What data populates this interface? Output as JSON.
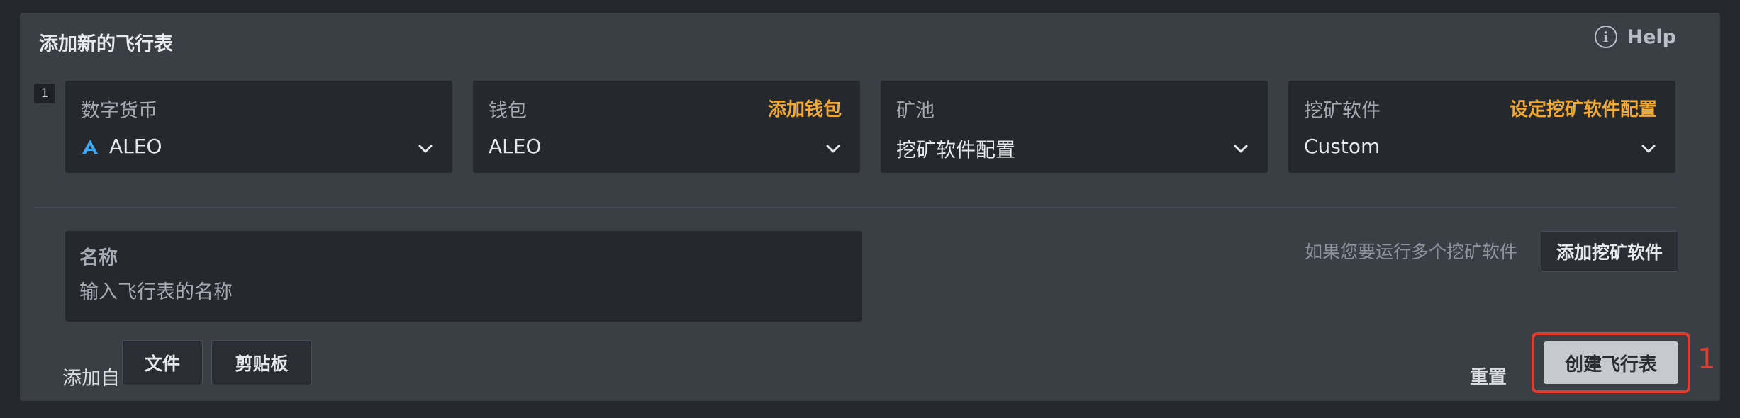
{
  "panel": {
    "title": "添加新的飞行表",
    "help_label": "Help",
    "help_icon": "info-circle-icon"
  },
  "row_number": "1",
  "fields": {
    "coin": {
      "label": "数字货币",
      "value": "ALEO",
      "icon": "aleo-logo-icon"
    },
    "wallet": {
      "label": "钱包",
      "link": "添加钱包",
      "value": "ALEO"
    },
    "pool": {
      "label": "矿池",
      "value": "挖矿软件配置"
    },
    "miner": {
      "label": "挖矿软件",
      "link": "设定挖矿软件配置",
      "value": "Custom"
    }
  },
  "name": {
    "label": "名称",
    "placeholder": "输入飞行表的名称"
  },
  "multi_miner": {
    "hint": "如果您要运行多个挖矿软件",
    "button": "添加挖矿软件"
  },
  "add_from": {
    "label": "添加自",
    "file_button": "文件",
    "clipboard_button": "剪贴板"
  },
  "actions": {
    "reset": "重置",
    "create": "创建飞行表"
  },
  "annotation": {
    "callout": "1"
  },
  "colors": {
    "accent_link": "#f0a934",
    "highlight_box": "#e23b2b",
    "aleo_logo": "#3aa8f2"
  }
}
